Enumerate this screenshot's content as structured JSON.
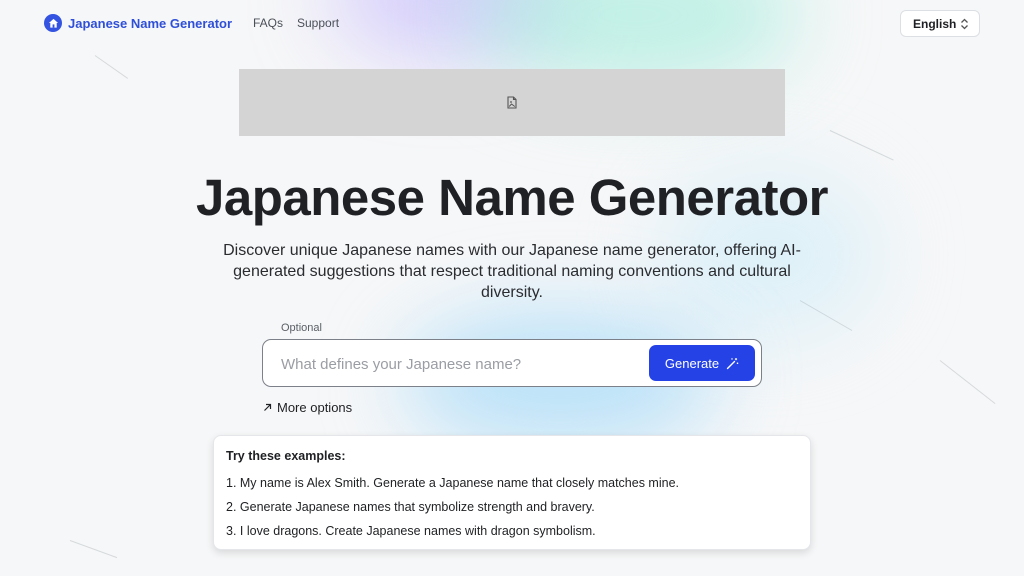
{
  "header": {
    "brand": "Japanese Name Generator",
    "nav": [
      "FAQs",
      "Support"
    ],
    "language": "English"
  },
  "hero": {
    "title": "Japanese Name Generator",
    "subtitle": "Discover unique Japanese names with our Japanese name generator, offering AI-generated suggestions that respect traditional naming conventions and cultural diversity."
  },
  "form": {
    "optional_label": "Optional",
    "placeholder": "What defines your Japanese name?",
    "input_value": "",
    "generate_label": "Generate",
    "more_options": "More options"
  },
  "examples": {
    "heading": "Try these examples:",
    "items": [
      "1. My name is Alex Smith. Generate a Japanese name that closely matches mine.",
      "2. Generate Japanese names that symbolize strength and bravery.",
      "3. I love dragons. Create Japanese names with dragon symbolism."
    ]
  },
  "icons": {
    "brand": "house-icon",
    "language": "chevron-up-down-icon",
    "banner": "image-placeholder-icon",
    "generate": "magic-wand-icon",
    "more": "arrow-up-right-icon"
  },
  "colors": {
    "accent": "#2442e6",
    "brand": "#2f4fd8"
  }
}
